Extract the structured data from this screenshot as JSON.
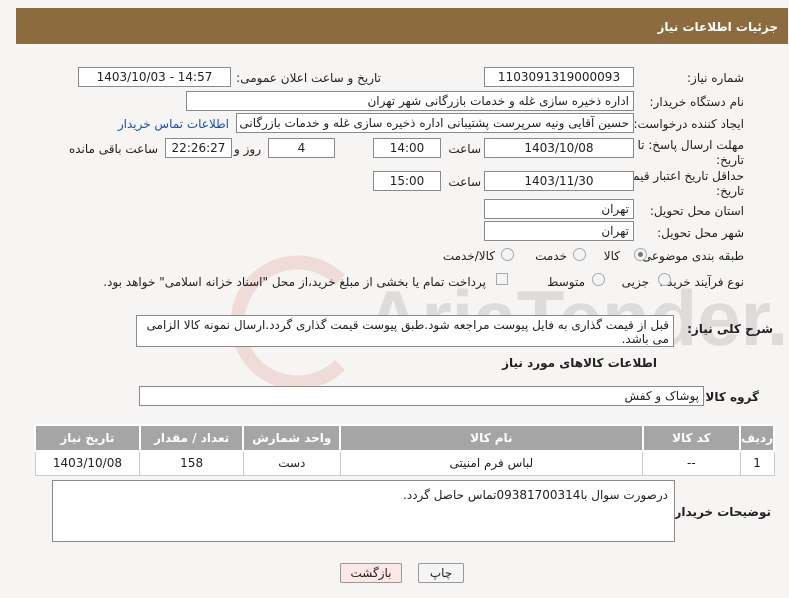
{
  "header": {
    "title": "جزئیات اطلاعات نیاز"
  },
  "fields": {
    "need_number_label": "شماره نیاز:",
    "need_number": "1103091319000093",
    "announce_label": "تاریخ و ساعت اعلان عمومی:",
    "announce_value": "1403/10/03 - 14:57",
    "buyer_org_label": "نام دستگاه خریدار:",
    "buyer_org": "اداره ذخیره سازی غله و خدمات بازرگانی شهر تهران",
    "requester_label": "ایجاد کننده درخواست:",
    "requester": "حسین آقایی ونیه سرپرست پشتیبانی اداره ذخیره سازی غله و خدمات بازرگانی شهر تهران",
    "contact_link": "اطلاعات تماس خریدار",
    "deadline_label_1": "مهلت ارسال پاسخ: تا",
    "deadline_label_2": "تاریخ:",
    "deadline_date": "1403/10/08",
    "time_label": "ساعت",
    "deadline_time": "14:00",
    "days_value": "4",
    "days_label": "روز و",
    "remaining_time": "22:26:27",
    "remaining_label": "ساعت باقی مانده",
    "validity_label_1": "حداقل تاریخ اعتبار قیمت: تا",
    "validity_label_2": "تاریخ:",
    "validity_date": "1403/11/30",
    "validity_time_label": "ساعت",
    "validity_time": "15:00",
    "province_label": "استان محل تحویل:",
    "province": "تهران",
    "city_label": "شهر محل تحویل:",
    "city": "تهران",
    "category_label": "طبقه بندی موضوعی:",
    "category_options": [
      "کالا",
      "خدمت",
      "کالا/خدمت"
    ],
    "process_label": "نوع فرآیند خرید :",
    "process_options": [
      "جزیی",
      "متوسط"
    ],
    "payment_note": "پرداخت تمام یا بخشی از مبلغ خرید،از محل \"اسناد خزانه اسلامی\" خواهد بود.",
    "description_label": "شرح کلی نیاز:",
    "description": "قبل از قیمت گذاری به فایل پیوست مراجعه شود.طبق پیوست قیمت گذاری گردد.ارسال نمونه کالا الزامی می باشد."
  },
  "goods": {
    "section_title": "اطلاعات کالاهای مورد نیاز",
    "group_label": "گروه کالا:",
    "group_value": "پوشاک و کفش",
    "columns": [
      "ردیف",
      "کد کالا",
      "نام کالا",
      "واحد شمارش",
      "تعداد / مقدار",
      "تاریخ نیاز"
    ],
    "rows": [
      [
        "1",
        "--",
        "لباس فرم امنیتی",
        "دست",
        "158",
        "1403/10/08"
      ]
    ]
  },
  "buyer_notes": {
    "label": "توضیحات خریدار:",
    "text": "درصورت سوال با09381700314تماس حاصل گردد."
  },
  "buttons": {
    "print": "چاپ",
    "back": "بازگشت"
  },
  "watermark": {
    "text": "AriaTender.neT"
  }
}
